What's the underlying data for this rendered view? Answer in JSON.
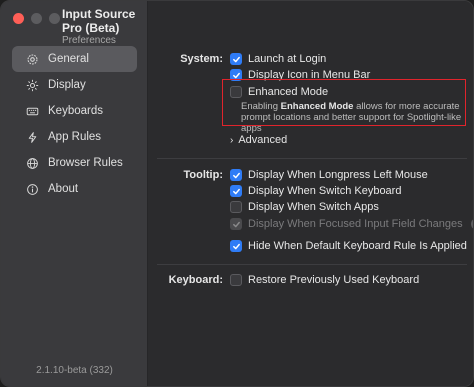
{
  "window": {
    "title": "Input Source Pro (Beta)",
    "subtitle": "Preferences"
  },
  "sidebar": {
    "items": [
      {
        "label": "General",
        "icon": "gear-icon",
        "active": true
      },
      {
        "label": "Display",
        "icon": "sun-icon",
        "active": false
      },
      {
        "label": "Keyboards",
        "icon": "keyboard-icon",
        "active": false
      },
      {
        "label": "App Rules",
        "icon": "app-rules-icon",
        "active": false
      },
      {
        "label": "Browser Rules",
        "icon": "globe-icon",
        "active": false
      },
      {
        "label": "About",
        "icon": "info-icon",
        "active": false
      }
    ],
    "version": "2.1.10-beta (332)"
  },
  "system": {
    "label": "System:",
    "launch_at_login": "Launch at Login",
    "display_icon_menu_bar": "Display Icon in Menu Bar",
    "enhanced_mode": "Enhanced Mode",
    "enhanced_desc_pre": "Enabling ",
    "enhanced_desc_bold": "Enhanced Mode",
    "enhanced_desc_post": " allows for more accurate prompt locations and better support for Spotlight-like apps",
    "advanced": "Advanced"
  },
  "tooltip": {
    "label": "Tooltip:",
    "longpress": "Display When Longpress Left Mouse",
    "switch_keyboard": "Display When Switch Keyboard",
    "switch_apps": "Display When Switch Apps",
    "focused_input": "Display When Focused Input Field Changes",
    "hide_default": "Hide When Default Keyboard Rule Is Applied"
  },
  "keyboard": {
    "label": "Keyboard:",
    "restore_previous": "Restore Previously Used Keyboard"
  },
  "colors": {
    "accent": "#2f7cf6",
    "highlight": "#e0242c",
    "sidebar_active": "#5a5a5e"
  }
}
